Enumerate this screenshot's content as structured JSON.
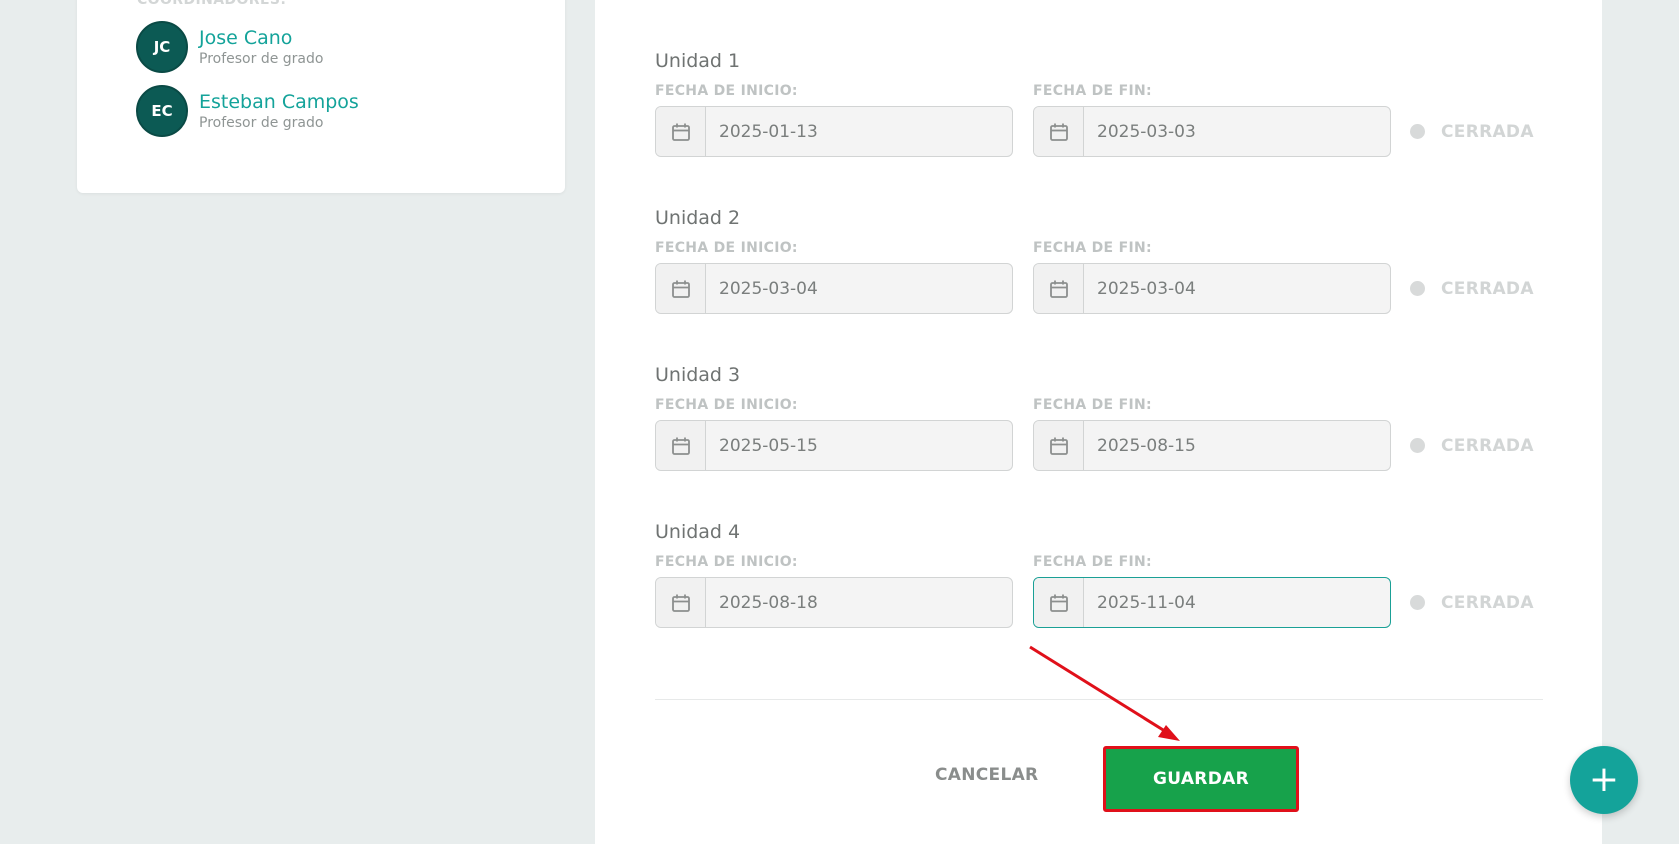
{
  "coordinators": {
    "heading": "COORDINADORES:",
    "people": [
      {
        "initials": "JC",
        "name": "Jose Cano",
        "role": "Profesor de grado"
      },
      {
        "initials": "EC",
        "name": "Esteban Campos",
        "role": "Profesor de grado"
      }
    ]
  },
  "labels": {
    "start": "FECHA DE INICIO:",
    "end": "FECHA DE FIN:"
  },
  "units": [
    {
      "title": "Unidad 1",
      "start": "2025-01-13",
      "end": "2025-03-03",
      "status": "CERRADA"
    },
    {
      "title": "Unidad 2",
      "start": "2025-03-04",
      "end": "2025-03-04",
      "status": "CERRADA"
    },
    {
      "title": "Unidad 3",
      "start": "2025-05-15",
      "end": "2025-08-15",
      "status": "CERRADA"
    },
    {
      "title": "Unidad 4",
      "start": "2025-08-18",
      "end": "2025-11-04",
      "status": "CERRADA"
    }
  ],
  "actions": {
    "cancel_label": "CANCELAR",
    "save_label": "GUARDAR",
    "fab_label": "+"
  },
  "colors": {
    "accent": "#14a39a",
    "save": "#17a24b",
    "highlight": "#e0101a"
  }
}
